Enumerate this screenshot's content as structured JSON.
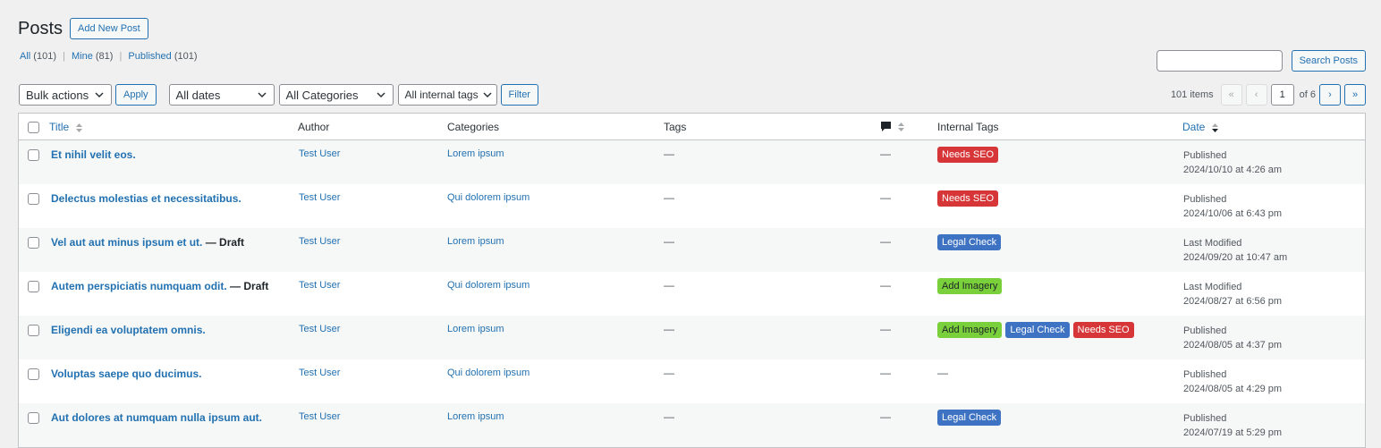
{
  "header": {
    "title": "Posts",
    "add_new_label": "Add New Post"
  },
  "views": [
    {
      "label": "All",
      "count": "(101)"
    },
    {
      "label": "Mine",
      "count": "(81)"
    },
    {
      "label": "Published",
      "count": "(101)"
    }
  ],
  "search": {
    "value": "",
    "button_label": "Search Posts"
  },
  "filters": {
    "bulk_actions": "Bulk actions",
    "apply_label": "Apply",
    "dates": "All dates",
    "categories": "All Categories",
    "internal_tags": "All internal tags",
    "filter_label": "Filter"
  },
  "pagination": {
    "items": "101 items",
    "first": "«",
    "prev": "‹",
    "current": "1",
    "of_text": "of 6",
    "next": "›",
    "last": "»"
  },
  "columns": {
    "title": "Title",
    "author": "Author",
    "categories": "Categories",
    "tags": "Tags",
    "internal_tags": "Internal Tags",
    "date": "Date"
  },
  "posts": [
    {
      "title": "Et nihil velit eos.",
      "state": "",
      "author": "Test User",
      "category": "Lorem ipsum",
      "tags": "—",
      "comments": "—",
      "internal_tags": [
        {
          "label": "Needs SEO",
          "kind": "needs-seo"
        }
      ],
      "internal_tags_empty": "",
      "date_status": "Published",
      "date_value": "2024/10/10 at 4:26 am"
    },
    {
      "title": "Delectus molestias et necessitatibus.",
      "state": "",
      "author": "Test User",
      "category": "Qui dolorem ipsum",
      "tags": "—",
      "comments": "—",
      "internal_tags": [
        {
          "label": "Needs SEO",
          "kind": "needs-seo"
        }
      ],
      "internal_tags_empty": "",
      "date_status": "Published",
      "date_value": "2024/10/06 at 6:43 pm"
    },
    {
      "title": "Vel aut aut minus ipsum et ut.",
      "state": " — Draft",
      "author": "Test User",
      "category": "Lorem ipsum",
      "tags": "—",
      "comments": "—",
      "internal_tags": [
        {
          "label": "Legal Check",
          "kind": "legal-check"
        }
      ],
      "internal_tags_empty": "",
      "date_status": "Last Modified",
      "date_value": "2024/09/20 at 10:47 am"
    },
    {
      "title": "Autem perspiciatis numquam odit.",
      "state": " — Draft",
      "author": "Test User",
      "category": "Qui dolorem ipsum",
      "tags": "—",
      "comments": "—",
      "internal_tags": [
        {
          "label": "Add Imagery",
          "kind": "add-imagery"
        }
      ],
      "internal_tags_empty": "",
      "date_status": "Last Modified",
      "date_value": "2024/08/27 at 6:56 pm"
    },
    {
      "title": "Eligendi ea voluptatem omnis.",
      "state": "",
      "author": "Test User",
      "category": "Lorem ipsum",
      "tags": "—",
      "comments": "—",
      "internal_tags": [
        {
          "label": "Add Imagery",
          "kind": "add-imagery"
        },
        {
          "label": "Legal Check",
          "kind": "legal-check"
        },
        {
          "label": "Needs SEO",
          "kind": "needs-seo"
        }
      ],
      "internal_tags_empty": "",
      "date_status": "Published",
      "date_value": "2024/08/05 at 4:37 pm"
    },
    {
      "title": "Voluptas saepe quo ducimus.",
      "state": "",
      "author": "Test User",
      "category": "Qui dolorem ipsum",
      "tags": "—",
      "comments": "—",
      "internal_tags": [],
      "internal_tags_empty": "—",
      "date_status": "Published",
      "date_value": "2024/08/05 at 4:29 pm"
    },
    {
      "title": "Aut dolores at numquam nulla ipsum aut.",
      "state": "",
      "author": "Test User",
      "category": "Lorem ipsum",
      "tags": "—",
      "comments": "—",
      "internal_tags": [
        {
          "label": "Legal Check",
          "kind": "legal-check"
        }
      ],
      "internal_tags_empty": "",
      "date_status": "Published",
      "date_value": "2024/07/19 at 5:29 pm"
    }
  ],
  "colors": {
    "link": "#2271b1",
    "needs_seo": "#d63638",
    "legal_check": "#3e72c3",
    "add_imagery": "#7ad03a"
  },
  "icons": {
    "comments_column": "comment-bubble-icon",
    "sort": "sort-arrows-icon",
    "dropdown": "chevron-down-icon"
  }
}
